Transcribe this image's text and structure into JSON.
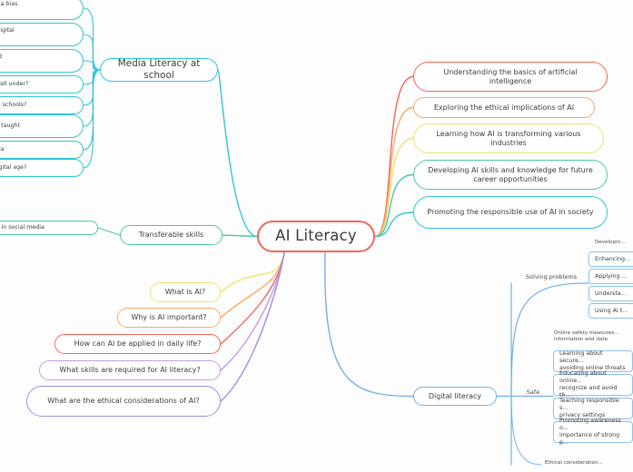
{
  "meta": {
    "background_color": "#fdfdfd",
    "text_color": "#3b3b3b",
    "diagram_type": "mind-map"
  },
  "palette": {
    "red": "#f4645a",
    "orange": "#f7a96a",
    "yellow": "#f5e06a",
    "green": "#4cc9a0",
    "cyan": "#2fc6d8",
    "blue": "#74aee8",
    "purple": "#c79ae8",
    "violet": "#9b8ce8",
    "light_blue": "#8fc0ea",
    "gray_text": "#4a4a4a"
  },
  "central": {
    "label": "AI Literacy",
    "color": "#f4645a"
  },
  "right_branches": [
    {
      "label": "Understanding the basics of artificial intelligence",
      "color": "#f4645a"
    },
    {
      "label": "Exploring the ethical implications of AI",
      "color": "#f7a96a"
    },
    {
      "label": "Learning how AI is transforming various industries",
      "color": "#f0e06a"
    },
    {
      "label": "Developing AI skills and knowledge for future career opportunities",
      "color": "#4cc9a0"
    },
    {
      "label": "Promoting the responsible use of AI in society",
      "color": "#2fc6d8"
    }
  ],
  "left_questions": [
    {
      "label": "What is AI?",
      "color": "#f5e06a"
    },
    {
      "label": "Why is AI important?",
      "color": "#f7a96a"
    },
    {
      "label": "How can AI be applied in daily life?",
      "color": "#f4645a"
    },
    {
      "label": "What skills are required for AI literacy?",
      "color": "#c79ae8"
    },
    {
      "label": "What are the ethical considerations of AI?",
      "color": "#9b8ce8"
    }
  ],
  "media_literacy": {
    "label": "Media Literacy at school",
    "color": "#2fc6d8",
    "children": [
      {
        "label": "...ncept of media bias\n...rmation",
        "color": "#2fc6d8"
      },
      {
        "label": "...ate and use digital\n...ally",
        "color": "#2fc6d8"
      },
      {
        "label": "...me active and\n...ia content",
        "color": "#2fc6d8"
      },
      {
        "label": "...edia literacy fall under?",
        "color": "#2fc6d8"
      },
      {
        "label": "...y taught in all schools?",
        "color": "#2fc6d8"
      },
      {
        "label": "...racy typically taught",
        "color": "#2fc6d8"
      },
      {
        "label": "...aught in media",
        "color": "#2fc6d8"
      },
      {
        "label": "...racy in the digital age?",
        "color": "#2fc6d8"
      }
    ]
  },
  "transferable_skills": {
    "label": "Transferable skills",
    "color": "#4cc9a0",
    "children": [
      {
        "label": "...nt engagement in social media",
        "color": "#4cc9a0"
      }
    ]
  },
  "digital_literacy": {
    "label": "Digital literacy",
    "color": "#74aee8",
    "subgroups": [
      {
        "label": "Solving problems",
        "color": "#74aee8",
        "items": [
          {
            "label": "Developin...",
            "color": "#8fc0ea",
            "boxed": false
          },
          {
            "label": "Enhancing...",
            "color": "#8fc0ea",
            "boxed": true
          },
          {
            "label": "Applying ...",
            "color": "#8fc0ea",
            "boxed": true
          },
          {
            "label": "Understa...",
            "color": "#8fc0ea",
            "boxed": true
          },
          {
            "label": "Using AI t...",
            "color": "#8fc0ea",
            "boxed": true
          }
        ]
      },
      {
        "label": "Safe",
        "color": "#74aee8",
        "header": "Online safety measures...\ninformation and data",
        "items": [
          {
            "label": "Learning about secure...\navoiding online threats",
            "color": "#8fc0ea",
            "boxed": true
          },
          {
            "label": "Educating about online...\nrecognize and avoid th...",
            "color": "#8fc0ea",
            "boxed": true
          },
          {
            "label": "Teaching responsible s...\nprivacy settings",
            "color": "#8fc0ea",
            "boxed": true
          },
          {
            "label": "Promoting awareness o...\nimportance of strong p...",
            "color": "#8fc0ea",
            "boxed": true
          }
        ]
      },
      {
        "label": "Ethical consideration...",
        "color": "#8fc0ea",
        "items": []
      }
    ]
  }
}
